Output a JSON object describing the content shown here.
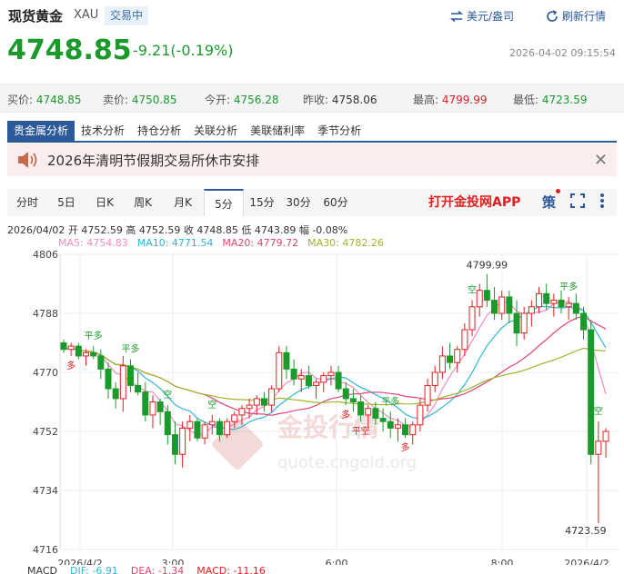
{
  "header": {
    "title": "现货黄金",
    "symbol": "XAU",
    "status_badge": "交易中",
    "currency_toggle": "美元/盎司",
    "refresh": "刷新行情",
    "price": "4748.85",
    "change": "-9.21(-0.19%)",
    "timestamp": "2026-04-02 09:15:54"
  },
  "stats": [
    {
      "label": "买价:",
      "value": "4748.85",
      "color": "#1a9a2a"
    },
    {
      "label": "卖价:",
      "value": "4750.85",
      "color": "#1a9a2a"
    },
    {
      "label": "今开:",
      "value": "4756.28",
      "color": "#1a9a2a"
    },
    {
      "label": "昨收:",
      "value": "4758.06",
      "color": "#333333"
    },
    {
      "label": "最高:",
      "value": "4799.99",
      "color": "#e02020"
    },
    {
      "label": "最低:",
      "value": "4723.59",
      "color": "#1a9a2a"
    }
  ],
  "analysis_tabs": [
    "贵金属分析",
    "技术分析",
    "持仓分析",
    "关联分析",
    "美联储利率",
    "季节分析"
  ],
  "notice": {
    "text": "2026年清明节假期交易所休市安排",
    "close": "✕"
  },
  "periods": [
    "分时",
    "5日",
    "日K",
    "周K",
    "月K",
    "5分",
    "15分",
    "30分",
    "60分"
  ],
  "active_period": "5分",
  "open_app": "打开金投网APP",
  "strategy_label": "策",
  "ohlc": "2026/04/02  开 4752.59  高 4752.59  收 4748.85  低 4743.89  幅 -0.08%",
  "ma": [
    {
      "text": "MA5: 4754.83",
      "color": "#f08cc0"
    },
    {
      "text": "MA10: 4771.54",
      "color": "#2fb5d8"
    },
    {
      "text": "MA20: 4779.72",
      "color": "#e0466e"
    },
    {
      "text": "MA30: 4782.26",
      "color": "#9cb52a"
    }
  ],
  "macd": [
    {
      "text": "MACD",
      "color": "#333333"
    },
    {
      "text": "DIF: -6.91",
      "color": "#2fb5d8"
    },
    {
      "text": "DEA: -1.34",
      "color": "#e0466e"
    },
    {
      "text": "MACD: -11.16",
      "color": "#e02020"
    }
  ],
  "watermark": {
    "name": "金投行情",
    "url": "quote.cngold.org"
  },
  "chart_data": {
    "type": "candlestick",
    "ylim": [
      4716,
      4806
    ],
    "y_ticks": [
      "4806",
      "4788",
      "4770",
      "4752",
      "4734",
      "4716"
    ],
    "x_ticks": [
      "2026/4/2",
      "3:00",
      "6:00",
      "8:00",
      "2026/4/2"
    ],
    "high_label": "4799.99",
    "low_label": "4723.59",
    "signal_labels": [
      "平多",
      "多",
      "平多",
      "空",
      "空",
      "平多",
      "多",
      "平空",
      "多",
      "空",
      "平多",
      "空"
    ],
    "candles": [
      [
        4779,
        4780,
        4776,
        4777
      ],
      [
        4777,
        4779,
        4775,
        4778
      ],
      [
        4778,
        4779,
        4774,
        4775
      ],
      [
        4775,
        4777,
        4772,
        4776
      ],
      [
        4776,
        4778,
        4774,
        4775
      ],
      [
        4775,
        4777,
        4768,
        4771
      ],
      [
        4771,
        4773,
        4762,
        4765
      ],
      [
        4765,
        4767,
        4759,
        4762
      ],
      [
        4762,
        4775,
        4758,
        4772
      ],
      [
        4772,
        4774,
        4764,
        4766
      ],
      [
        4766,
        4770,
        4763,
        4764
      ],
      [
        4764,
        4767,
        4755,
        4757
      ],
      [
        4757,
        4763,
        4753,
        4761
      ],
      [
        4761,
        4762,
        4754,
        4758
      ],
      [
        4758,
        4760,
        4748,
        4751
      ],
      [
        4751,
        4755,
        4742,
        4745
      ],
      [
        4745,
        4755,
        4741,
        4753
      ],
      [
        4753,
        4757,
        4749,
        4755
      ],
      [
        4755,
        4756,
        4749,
        4750
      ],
      [
        4750,
        4755,
        4748,
        4754
      ],
      [
        4754,
        4757,
        4751,
        4755
      ],
      [
        4755,
        4756,
        4749,
        4751
      ],
      [
        4751,
        4756,
        4750,
        4755
      ],
      [
        4755,
        4758,
        4753,
        4757
      ],
      [
        4757,
        4760,
        4754,
        4759
      ],
      [
        4759,
        4762,
        4756,
        4760
      ],
      [
        4760,
        4763,
        4757,
        4762
      ],
      [
        4762,
        4764,
        4758,
        4760
      ],
      [
        4760,
        4766,
        4758,
        4765
      ],
      [
        4765,
        4778,
        4764,
        4776
      ],
      [
        4776,
        4778,
        4768,
        4771
      ],
      [
        4771,
        4774,
        4766,
        4768
      ],
      [
        4768,
        4771,
        4764,
        4769
      ],
      [
        4769,
        4772,
        4765,
        4766
      ],
      [
        4766,
        4768,
        4762,
        4767
      ],
      [
        4767,
        4770,
        4764,
        4769
      ],
      [
        4769,
        4772,
        4766,
        4770
      ],
      [
        4770,
        4772,
        4764,
        4765
      ],
      [
        4765,
        4767,
        4760,
        4762
      ],
      [
        4762,
        4765,
        4758,
        4761
      ],
      [
        4761,
        4763,
        4755,
        4757
      ],
      [
        4757,
        4760,
        4753,
        4759
      ],
      [
        4759,
        4761,
        4754,
        4756
      ],
      [
        4756,
        4759,
        4752,
        4755
      ],
      [
        4755,
        4758,
        4750,
        4753
      ],
      [
        4753,
        4756,
        4749,
        4754
      ],
      [
        4754,
        4756,
        4750,
        4751
      ],
      [
        4751,
        4755,
        4748,
        4754
      ],
      [
        4754,
        4762,
        4752,
        4760
      ],
      [
        4760,
        4768,
        4758,
        4766
      ],
      [
        4766,
        4772,
        4764,
        4770
      ],
      [
        4770,
        4778,
        4768,
        4775
      ],
      [
        4775,
        4779,
        4771,
        4773
      ],
      [
        4773,
        4778,
        4770,
        4777
      ],
      [
        4777,
        4785,
        4775,
        4783
      ],
      [
        4783,
        4792,
        4781,
        4790
      ],
      [
        4790,
        4797,
        4787,
        4795
      ],
      [
        4795,
        4800,
        4790,
        4792
      ],
      [
        4792,
        4796,
        4786,
        4788
      ],
      [
        4788,
        4795,
        4786,
        4793
      ],
      [
        4793,
        4795,
        4785,
        4788
      ],
      [
        4788,
        4792,
        4778,
        4782
      ],
      [
        4782,
        4790,
        4780,
        4788
      ],
      [
        4788,
        4792,
        4784,
        4790
      ],
      [
        4790,
        4796,
        4788,
        4794
      ],
      [
        4794,
        4797,
        4789,
        4791
      ],
      [
        4791,
        4794,
        4787,
        4792
      ],
      [
        4792,
        4795,
        4788,
        4790
      ],
      [
        4790,
        4793,
        4786,
        4791
      ],
      [
        4791,
        4794,
        4786,
        4788
      ],
      [
        4788,
        4790,
        4780,
        4783
      ],
      [
        4783,
        4786,
        4742,
        4745
      ],
      [
        4745,
        4755,
        4724,
        4749
      ],
      [
        4749,
        4753,
        4744,
        4752
      ]
    ]
  }
}
